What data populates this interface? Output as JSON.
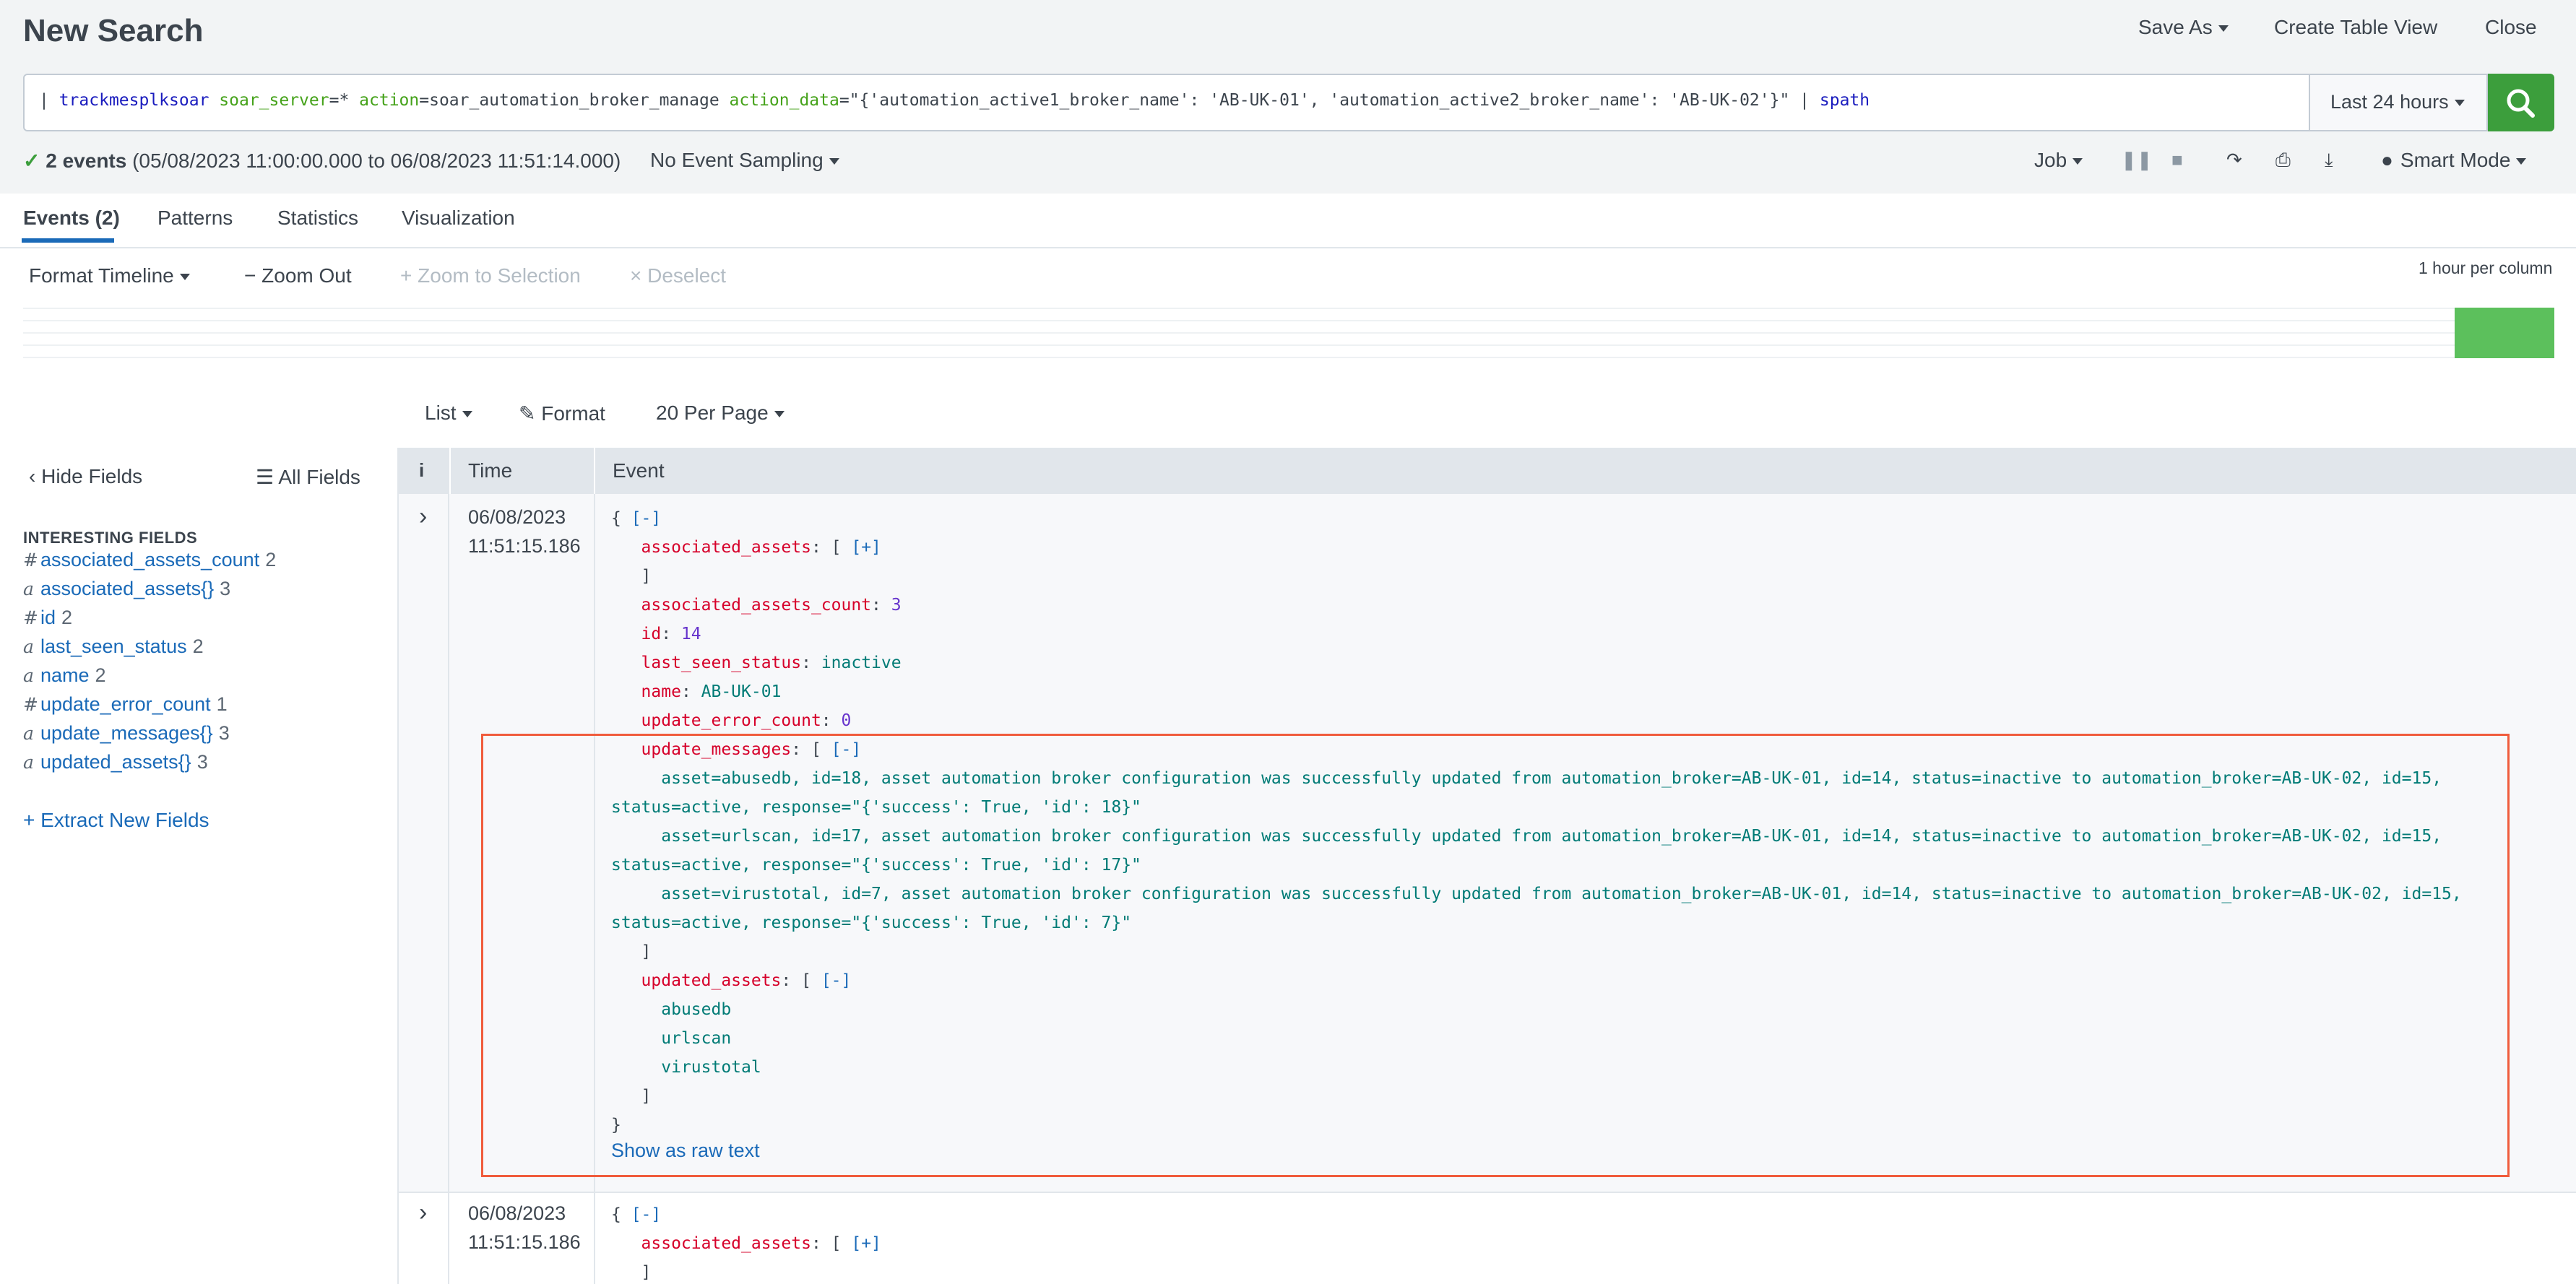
{
  "header": {
    "title": "New Search",
    "save_as": "Save As",
    "create_table_view": "Create Table View",
    "close": "Close"
  },
  "search": {
    "q_pipe": "| ",
    "q_index": "trackmesplksoar",
    "q_sp1": " ",
    "q_field1": "soar_server",
    "q_v1": "=* ",
    "q_field2": "action",
    "q_v2": "=soar_automation_broker_manage ",
    "q_field3": "action_data",
    "q_v3": "=\"{'automation_active1_broker_name': 'AB-UK-01', 'automation_active2_broker_name': 'AB-UK-02'}\" | ",
    "q_cmd": "spath",
    "time_range": "Last 24 hours"
  },
  "status": {
    "events_count": "2 events",
    "events_range": "(05/08/2023 11:00:00.000 to 06/08/2023 11:51:14.000)",
    "sampling": "No Event Sampling",
    "job": "Job",
    "mode": "Smart Mode"
  },
  "tabs": [
    {
      "label": "Events (2)"
    },
    {
      "label": "Patterns"
    },
    {
      "label": "Statistics"
    },
    {
      "label": "Visualization"
    }
  ],
  "timeline": {
    "format": "Format Timeline",
    "zoom_out": "Zoom Out",
    "zoom_selection": "Zoom to Selection",
    "deselect": "Deselect",
    "scale": "1 hour per column"
  },
  "list_controls": {
    "list": "List",
    "format": "Format",
    "per_page": "20 Per Page"
  },
  "sidebar": {
    "hide_fields": "Hide Fields",
    "all_fields": "All Fields",
    "section_title": "INTERESTING FIELDS",
    "fields": [
      {
        "type": "#",
        "name": "associated_assets_count",
        "count": "2"
      },
      {
        "type": "a",
        "name": "associated_assets{}",
        "count": "3"
      },
      {
        "type": "#",
        "name": "id",
        "count": "2"
      },
      {
        "type": "a",
        "name": "last_seen_status",
        "count": "2"
      },
      {
        "type": "a",
        "name": "name",
        "count": "2"
      },
      {
        "type": "#",
        "name": "update_error_count",
        "count": "1"
      },
      {
        "type": "a",
        "name": "update_messages{}",
        "count": "3"
      },
      {
        "type": "a",
        "name": "updated_assets{}",
        "count": "3"
      }
    ],
    "extract": "Extract New Fields"
  },
  "table": {
    "col_i": "i",
    "col_time": "Time",
    "col_event": "Event"
  },
  "events": [
    {
      "date": "06/08/2023",
      "clock": "11:51:15.186",
      "open": "{ ",
      "collapse": "[-]",
      "expand": "[+]",
      "k_assoc": "associated_assets",
      "p_arr": ": [ ",
      "close_br": "]",
      "k_count": "associated_assets_count",
      "colon": ": ",
      "v_count": "3",
      "k_id": "id",
      "v_id": "14",
      "k_status": "last_seen_status",
      "v_status": "inactive",
      "k_name": "name",
      "v_name": "AB-UK-01",
      "k_err": "update_error_count",
      "v_err": "0",
      "k_msgs": "update_messages",
      "m1a": "asset=abusedb, id=18, asset automation broker configuration was successfully updated from automation_broker=AB-UK-01, id=14, status=inactive to automation_broker=AB-UK-02, id=15,",
      "m1b": "status=active, response=\"{'success': True, 'id': 18}\"",
      "m2a": "asset=urlscan, id=17, asset automation broker configuration was successfully updated from automation_broker=AB-UK-01, id=14, status=inactive to automation_broker=AB-UK-02, id=15,",
      "m2b": "status=active, response=\"{'success': True, 'id': 17}\"",
      "m3a": "asset=virustotal, id=7, asset automation broker configuration was successfully updated from automation_broker=AB-UK-01, id=14, status=inactive to automation_broker=AB-UK-02, id=15,",
      "m3b": "status=active, response=\"{'success': True, 'id': 7}\"",
      "k_upd": "updated_assets",
      "a1": "abusedb",
      "a2": "urlscan",
      "a3": "virustotal",
      "end": "}",
      "raw": "Show as raw text"
    },
    {
      "date": "06/08/2023",
      "clock": "11:51:15.186",
      "open": "{ ",
      "collapse": "[-]",
      "expand": "[+]",
      "k_assoc": "associated_assets",
      "p_arr": ": [ ",
      "close_br": "]"
    }
  ],
  "colors": {
    "accent": "#1a6ab8",
    "go_button": "#3c9e3c",
    "timeline_bar": "#5cc05c",
    "highlight": "#f05c3c",
    "json_key": "#d6002a",
    "json_value": "#007b76"
  }
}
